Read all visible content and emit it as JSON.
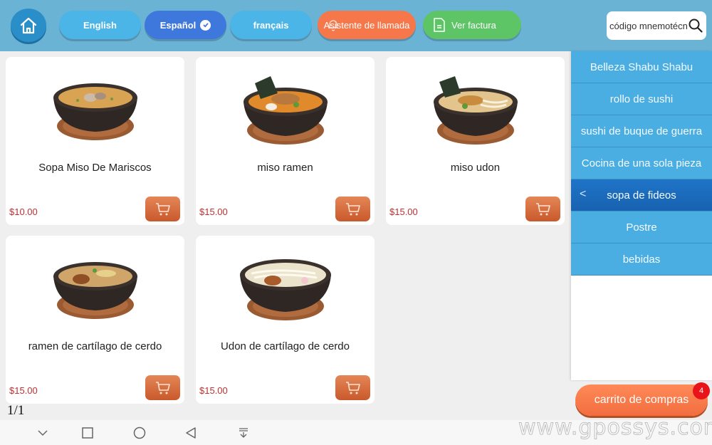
{
  "header": {
    "home_icon": "home-icon",
    "languages": [
      {
        "label": "English",
        "selected": false
      },
      {
        "label": "Español",
        "selected": true
      },
      {
        "label": "français",
        "selected": false
      }
    ],
    "call_assistant_label": "Asistente de llamada",
    "view_invoice_label": "Ver factura",
    "search": {
      "placeholder": "código mnemotécnico",
      "value": ""
    },
    "colors": {
      "bar": "#6ab3d5",
      "lang": "#4ab5e6",
      "lang_active": "#3f78dc",
      "call": "#f6774a",
      "invoice": "#5ec566"
    }
  },
  "products": [
    {
      "name": "Sopa Miso De Mariscos",
      "price": "$10.00"
    },
    {
      "name": "miso ramen",
      "price": "$15.00"
    },
    {
      "name": "miso udon",
      "price": "$15.00"
    },
    {
      "name": "ramen de cartílago de cerdo",
      "price": "$15.00"
    },
    {
      "name": "Udon de cartílago de cerdo",
      "price": "$15.00"
    }
  ],
  "pagination": {
    "text": "1/1"
  },
  "sidebar": {
    "categories": [
      {
        "label": "Belleza Shabu Shabu",
        "active": false
      },
      {
        "label": "rollo de sushi",
        "active": false
      },
      {
        "label": "sushi de buque de guerra",
        "active": false
      },
      {
        "label": "Cocina de una sola pieza",
        "active": false
      },
      {
        "label": "sopa de fideos",
        "active": true
      },
      {
        "label": "Postre",
        "active": false
      },
      {
        "label": "bebidas",
        "active": false
      }
    ],
    "active_chevron": "<"
  },
  "cart": {
    "label": "carrito de compras",
    "count": "4"
  },
  "watermark": "www.gpossys.com"
}
